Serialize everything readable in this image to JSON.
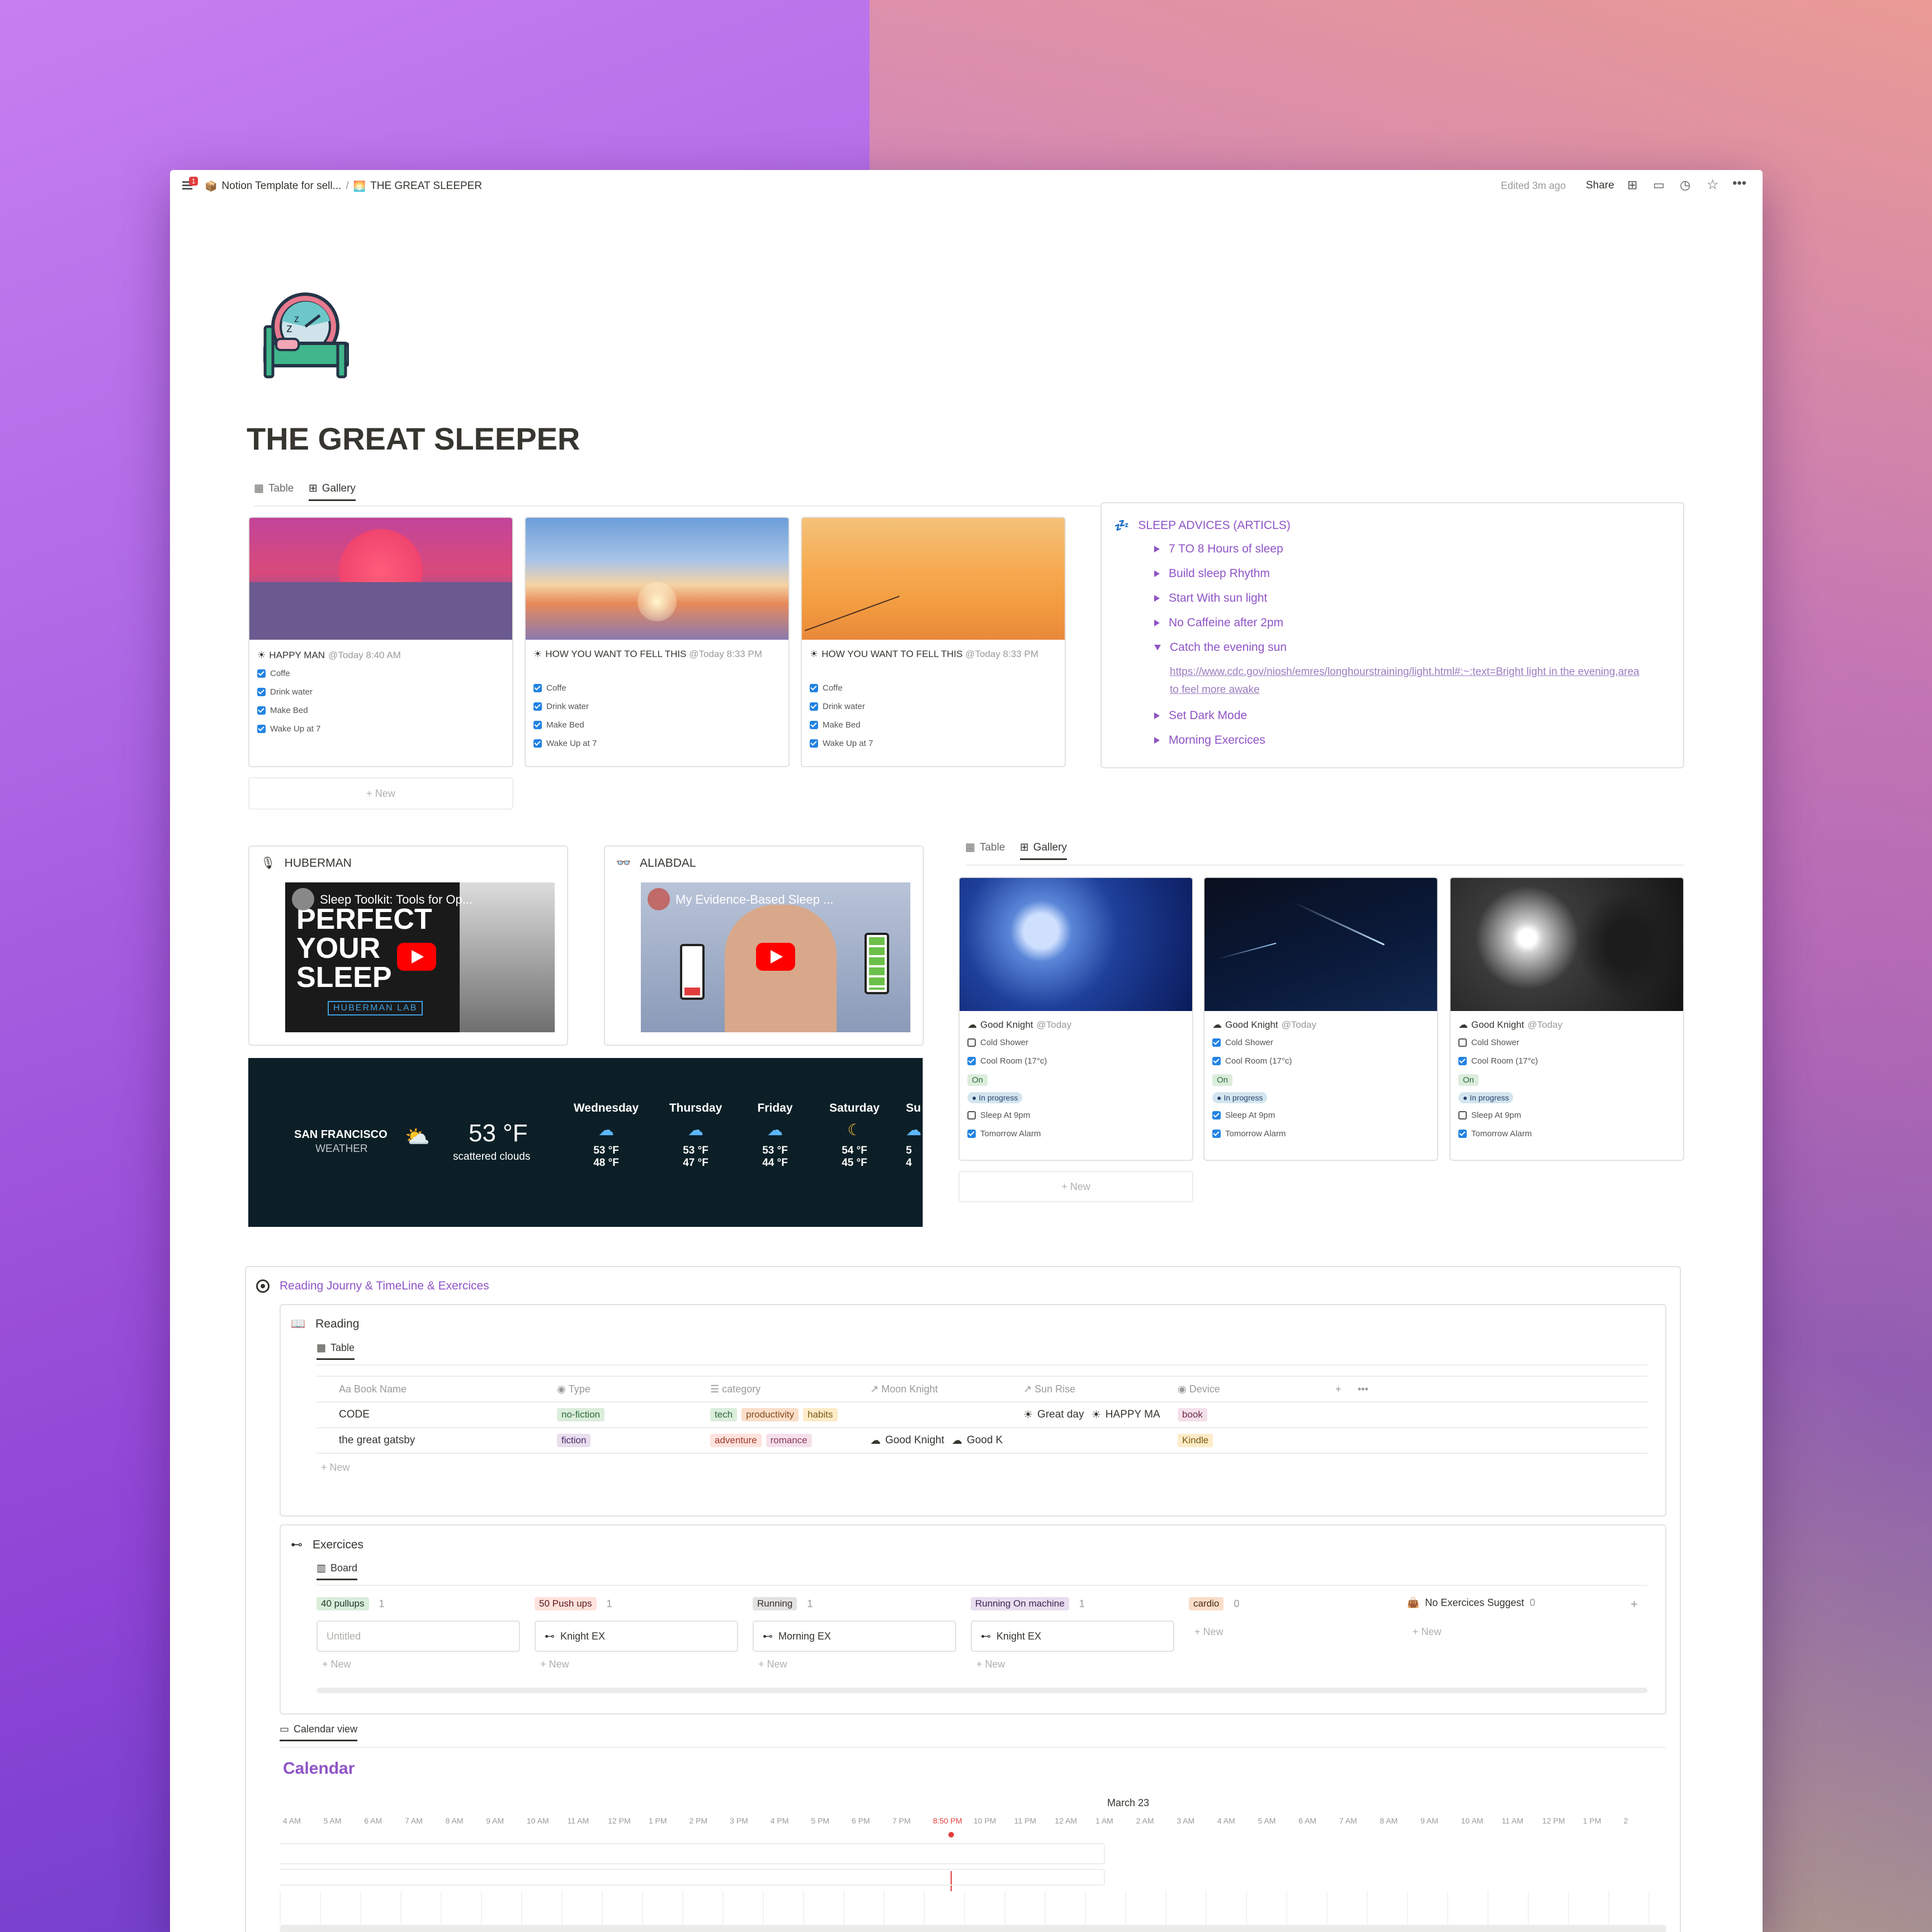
{
  "window": {
    "breadcrumb": [
      {
        "label": "Notion Template for sell..."
      },
      {
        "label": "THE GREAT SLEEPER"
      }
    ],
    "notification_count": "1",
    "edited": "Edited 3m ago",
    "share": "Share"
  },
  "page": {
    "title": "THE GREAT SLEEPER"
  },
  "gallery1": {
    "tabs": [
      "Table",
      "Gallery"
    ],
    "cards": [
      {
        "title": "HAPPY MAN",
        "date": "@Today 8:40 AM",
        "items": [
          "Coffe",
          "Drink water",
          "Make Bed",
          "Wake Up at 7"
        ]
      },
      {
        "title": "HOW YOU WANT TO FELL THIS",
        "date": "@Today 8:33 PM",
        "items": [
          "Coffe",
          "Drink water",
          "Make Bed",
          "Wake Up at 7"
        ]
      },
      {
        "title": "HOW YOU WANT TO FELL THIS",
        "date": "@Today 8:33 PM",
        "items": [
          "Coffe",
          "Drink water",
          "Make Bed",
          "Wake Up at 7"
        ]
      }
    ],
    "new": "+ New"
  },
  "advices": {
    "title": "SLEEP ADVICES (ARTICLS)",
    "items": [
      "7 TO 8 Hours of sleep",
      "Build sleep Rhythm",
      "Start With sun light",
      "No Caffeine after 2pm",
      "Catch the evening sun"
    ],
    "link": "https://www.cdc.gov/niosh/emres/longhourstraining/light.html#:~:text=Bright light in the evening,area to feel more awake",
    "items2": [
      "Set Dark Mode",
      "Morning Exercices"
    ]
  },
  "videos": [
    {
      "label": "HUBERMAN",
      "video_title": "Sleep Toolkit: Tools for Op...",
      "thumb_text": [
        "PERFECT",
        "YOUR",
        "SLEEP"
      ],
      "lab": "HUBERMAN LAB"
    },
    {
      "label": "ALIABDAL",
      "video_title": "My Evidence-Based Sleep ..."
    }
  ],
  "weather": {
    "city": "SAN FRANCISCO",
    "sub": "WEATHER",
    "temp": "53 °F",
    "desc": "scattered clouds",
    "days": [
      {
        "day": "Wednesday",
        "hi": "53 °F",
        "lo": "48 °F",
        "icon": "rain-cloud-icon"
      },
      {
        "day": "Thursday",
        "hi": "53 °F",
        "lo": "47 °F",
        "icon": "rain-cloud-icon"
      },
      {
        "day": "Friday",
        "hi": "53 °F",
        "lo": "44 °F",
        "icon": "cloud-icon"
      },
      {
        "day": "Saturday",
        "hi": "54 °F",
        "lo": "45 °F",
        "icon": "moon-icon"
      },
      {
        "day": "Su",
        "hi": "5",
        "lo": "4",
        "icon": "cloud-icon"
      }
    ]
  },
  "gallery2": {
    "tabs": [
      "Table",
      "Gallery"
    ],
    "cards": [
      {
        "title": "Good Knight",
        "date": "@Today",
        "status": "On",
        "progress": "In progress",
        "items": [
          {
            "label": "Cold Shower",
            "checked": false
          },
          {
            "label": "Cool Room (17°c)",
            "checked": true
          },
          {
            "label": "Sleep At 9pm",
            "checked": false
          },
          {
            "label": "Tomorrow Alarm",
            "checked": true
          }
        ]
      },
      {
        "title": "Good Knight",
        "date": "@Today",
        "status": "On",
        "progress": "In progress",
        "items": [
          {
            "label": "Cold Shower",
            "checked": true
          },
          {
            "label": "Cool Room (17°c)",
            "checked": true
          },
          {
            "label": "Sleep At 9pm",
            "checked": true
          },
          {
            "label": "Tomorrow Alarm",
            "checked": true
          }
        ]
      },
      {
        "title": "Good Knight",
        "date": "@Today",
        "status": "On",
        "progress": "In progress",
        "items": [
          {
            "label": "Cold Shower",
            "checked": false
          },
          {
            "label": "Cool Room (17°c)",
            "checked": true
          },
          {
            "label": "Sleep At 9pm",
            "checked": false
          },
          {
            "label": "Tomorrow Alarm",
            "checked": true
          }
        ]
      }
    ],
    "new": "+ New"
  },
  "reading_section": {
    "title": "Reading Journy & TimeLine & Exercices",
    "reading": {
      "title": "Reading",
      "view": "Table",
      "columns": [
        "Aa Book Name",
        "Type",
        "category",
        "Moon Knight",
        "Sun Rise",
        "Device"
      ],
      "rows": [
        {
          "name": "CODE",
          "type": "no-fiction",
          "category": [
            "tech",
            "productivity",
            "habits"
          ],
          "moon": [],
          "sun": [
            "Great day",
            "HAPPY MA"
          ],
          "device": "book"
        },
        {
          "name": "the great gatsby",
          "type": "fiction",
          "category": [
            "adventure",
            "romance"
          ],
          "moon": [
            "Good Knight",
            "Good K"
          ],
          "sun": [],
          "device": "Kindle"
        }
      ],
      "new": "+ New"
    },
    "exercices": {
      "title": "Exercices",
      "view": "Board",
      "lanes": [
        {
          "name": "40 pullups",
          "count": "1",
          "card": "Untitled",
          "color": "#dbeddb",
          "text": "#1c3829"
        },
        {
          "name": "50 Push ups",
          "count": "1",
          "card": "Knight EX",
          "color": "#ffe2dd",
          "text": "#5d1715"
        },
        {
          "name": "Running",
          "count": "1",
          "card": "Morning EX",
          "color": "#e3e2e0",
          "text": "#32302c"
        },
        {
          "name": "Running On machine",
          "count": "1",
          "card": "Knight EX",
          "color": "#e8deee",
          "text": "#412454"
        },
        {
          "name": "cardio",
          "count": "0",
          "card": "",
          "color": "#fadec9",
          "text": "#49290e"
        },
        {
          "name": "No Exercices Suggest",
          "count": "0",
          "card": "",
          "color": "",
          "text": "#37352f"
        }
      ],
      "new": "+ New",
      "add": "+"
    },
    "calendar": {
      "view": "Calendar view",
      "title": "Calendar",
      "date": "March 23",
      "now": "8:50 PM",
      "ticks": [
        "4 AM",
        "5 AM",
        "6 AM",
        "7 AM",
        "8 AM",
        "9 AM",
        "10 AM",
        "11 AM",
        "12 PM",
        "1 PM",
        "2 PM",
        "3 PM",
        "4 PM",
        "5 PM",
        "6 PM",
        "7 PM",
        "8:50 PM",
        "10 PM",
        "11 PM",
        "12 AM",
        "1 AM",
        "2 AM",
        "3 AM",
        "4 AM",
        "5 AM",
        "6 AM",
        "7 AM",
        "8 AM",
        "9 AM",
        "10 AM",
        "11 AM",
        "12 PM",
        "1 PM",
        "2"
      ]
    }
  },
  "colors": {
    "accent": "#8f54c6",
    "checkbox": "#2383e2",
    "weather_bg": "#0c1f26"
  }
}
